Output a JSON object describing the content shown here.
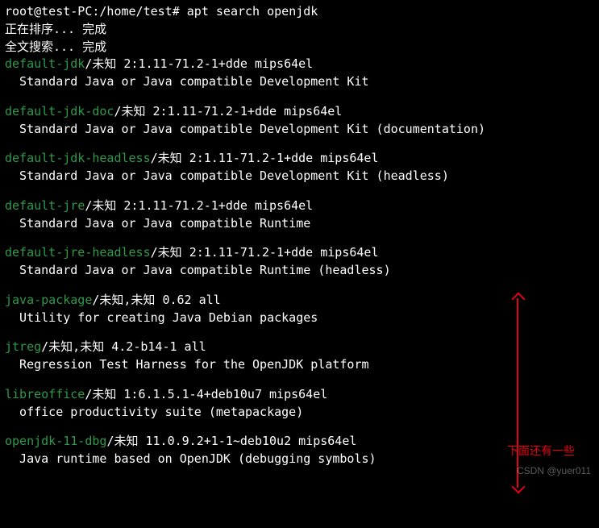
{
  "prompt": {
    "user": "root",
    "host": "test-PC",
    "path": "/home/test",
    "symbol": "#",
    "command": "apt search openjdk"
  },
  "progress": {
    "sorting": "正在排序... 完成",
    "fulltext": "全文搜索... 完成"
  },
  "packages": [
    {
      "name": "default-jdk",
      "status": "/未知",
      "version": "2:1.11-71.2-1+dde mips64el",
      "desc": "Standard Java or Java compatible Development Kit"
    },
    {
      "name": "default-jdk-doc",
      "status": "/未知",
      "version": "2:1.11-71.2-1+dde mips64el",
      "desc": "Standard Java or Java compatible Development Kit (documentation)"
    },
    {
      "name": "default-jdk-headless",
      "status": "/未知",
      "version": "2:1.11-71.2-1+dde mips64el",
      "desc": "Standard Java or Java compatible Development Kit (headless)"
    },
    {
      "name": "default-jre",
      "status": "/未知",
      "version": "2:1.11-71.2-1+dde mips64el",
      "desc": "Standard Java or Java compatible Runtime"
    },
    {
      "name": "default-jre-headless",
      "status": "/未知",
      "version": "2:1.11-71.2-1+dde mips64el",
      "desc": "Standard Java or Java compatible Runtime (headless)"
    },
    {
      "name": "java-package",
      "status": "/未知,未知",
      "version": "0.62 all",
      "desc": "Utility for creating Java Debian packages"
    },
    {
      "name": "jtreg",
      "status": "/未知,未知",
      "version": "4.2-b14-1 all",
      "desc": "Regression Test Harness for the OpenJDK platform"
    },
    {
      "name": "libreoffice",
      "status": "/未知",
      "version": "1:6.1.5.1-4+deb10u7 mips64el",
      "desc": "office productivity suite (metapackage)"
    },
    {
      "name": "openjdk-11-dbg",
      "status": "/未知",
      "version": "11.0.9.2+1-1~deb10u2 mips64el",
      "desc": "Java runtime based on OpenJDK (debugging symbols)"
    }
  ],
  "annotation": {
    "text": "下面还有一些"
  },
  "watermark": {
    "line1": "CSDN @yuer011"
  }
}
